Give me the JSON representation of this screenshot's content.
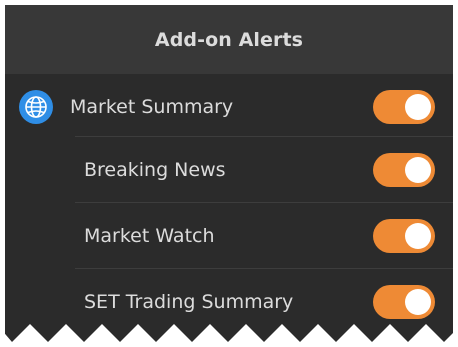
{
  "header": {
    "title": "Add-on Alerts"
  },
  "alerts": {
    "main": {
      "label": "Market Summary",
      "icon": "globe-icon",
      "enabled": true
    },
    "items": [
      {
        "label": "Breaking News",
        "enabled": true
      },
      {
        "label": "Market Watch",
        "enabled": true
      },
      {
        "label": "SET Trading Summary",
        "enabled": true
      }
    ]
  },
  "colors": {
    "panel_background": "#2b2b2b",
    "header_background": "#383838",
    "toggle_on": "#ee8a35",
    "icon_accent": "#2f8ee6"
  }
}
